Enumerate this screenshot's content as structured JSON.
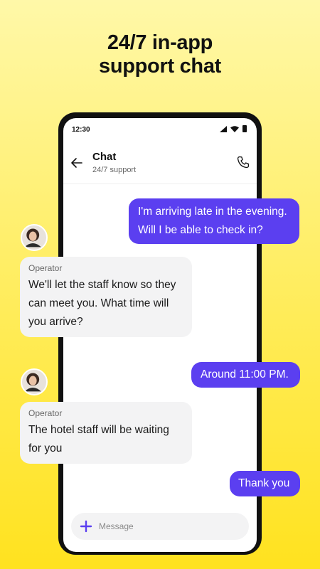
{
  "headline": {
    "line1": "24/7 in-app",
    "line2": "support chat"
  },
  "status_bar": {
    "time": "12:30"
  },
  "header": {
    "title": "Chat",
    "subtitle": "24/7 support"
  },
  "messages": [
    {
      "direction": "outgoing",
      "text": "I'm arriving late in the evening. Will I be able to check in?"
    },
    {
      "direction": "incoming",
      "sender": "Operator",
      "text": "We'll let the staff know so they can meet you. What time will you arrive?"
    },
    {
      "direction": "outgoing",
      "text": "Around 11:00 PM."
    },
    {
      "direction": "incoming",
      "sender": "Operator",
      "text": "The hotel staff will be waiting for you"
    },
    {
      "direction": "outgoing",
      "text": "Thank you"
    }
  ],
  "input": {
    "placeholder": "Message"
  },
  "icons": {
    "back": "arrow-left-icon",
    "call": "phone-icon",
    "attach": "plus-icon"
  },
  "colors": {
    "background": "#ffe21f",
    "outgoing_bubble": "#5b3ff0",
    "incoming_bubble": "#f3f3f4",
    "accent": "#5b3ff0"
  }
}
